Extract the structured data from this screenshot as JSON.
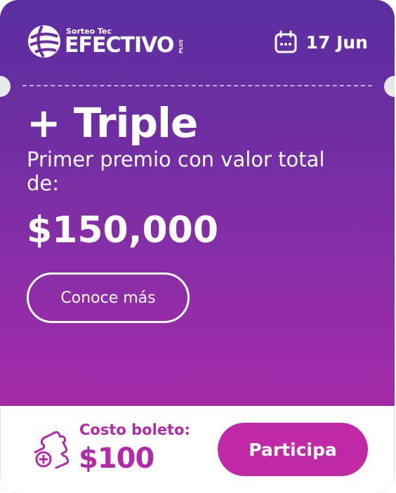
{
  "header": {
    "logo": {
      "small_text": "Sorteo Tec",
      "big_text": "EFECTIVO",
      "plus_text": "PLUS"
    },
    "date": "17 Jun",
    "date_icon": "calendar-icon"
  },
  "main": {
    "title": "+ Triple",
    "subtitle": "Primer premio con valor total de:",
    "amount": "$150,000",
    "more_button_label": "Conoce más"
  },
  "footer": {
    "ticket_icon": "ticket-plus-icon",
    "cost_label": "Costo boleto:",
    "cost_value": "$100",
    "participate_button_label": "Participa"
  },
  "colors": {
    "gradient_top": "#5a2fa0",
    "gradient_bottom": "#b02aa6",
    "accent": "#c12aa6",
    "footer_bg": "#ffffff"
  }
}
